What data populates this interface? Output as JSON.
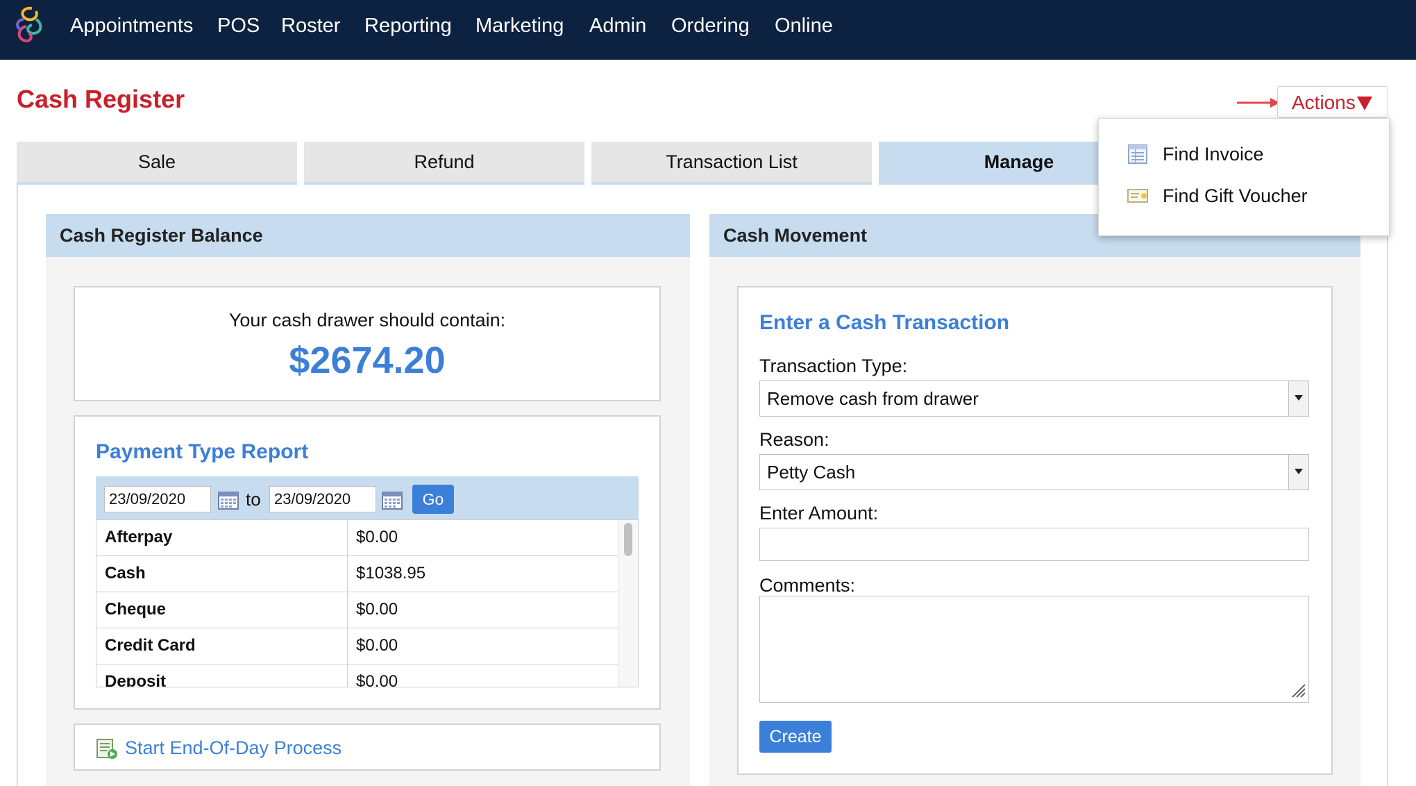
{
  "nav": {
    "items": [
      "Appointments",
      "POS",
      "Roster",
      "Reporting",
      "Marketing",
      "Admin",
      "Ordering",
      "Online"
    ],
    "active_item": "POS",
    "logo_icon": "spiral-logo-icon"
  },
  "page": {
    "title": "Cash Register"
  },
  "actions": {
    "label": "Actions",
    "menu": [
      {
        "label": "Find Invoice",
        "icon": "invoice-icon"
      },
      {
        "label": "Find Gift Voucher",
        "icon": "gift-voucher-icon"
      }
    ]
  },
  "tabs": [
    {
      "label": "Sale"
    },
    {
      "label": "Refund"
    },
    {
      "label": "Transaction List"
    },
    {
      "label": "Manage",
      "active": true
    }
  ],
  "balance": {
    "heading": "Cash Register Balance",
    "drawer_label": "Your cash drawer should contain:",
    "drawer_amount": "$2674.20"
  },
  "payment_report": {
    "heading": "Payment Type Report",
    "date_from": "23/09/2020",
    "to_label": "to",
    "date_to": "23/09/2020",
    "go_label": "Go",
    "rows": [
      {
        "type": "Afterpay",
        "amount": "$0.00"
      },
      {
        "type": "Cash",
        "amount": "$1038.95"
      },
      {
        "type": "Cheque",
        "amount": "$0.00"
      },
      {
        "type": "Credit Card",
        "amount": "$0.00"
      },
      {
        "type": "Deposit",
        "amount": "$0.00"
      }
    ]
  },
  "end_of_day": {
    "label": "Start End-Of-Day Process"
  },
  "cash_movement": {
    "heading": "Cash Movement",
    "form_title": "Enter a Cash Transaction",
    "transaction_type_label": "Transaction Type:",
    "transaction_type_value": "Remove cash from drawer",
    "reason_label": "Reason:",
    "reason_value": "Petty Cash",
    "amount_label": "Enter Amount:",
    "amount_value": "",
    "comments_label": "Comments:",
    "comments_value": "",
    "create_label": "Create"
  },
  "colors": {
    "nav_bg": "#0d2240",
    "brand_red": "#c8202b",
    "accent_blue": "#3c7fd8",
    "panel_blue": "#c7dcef"
  }
}
